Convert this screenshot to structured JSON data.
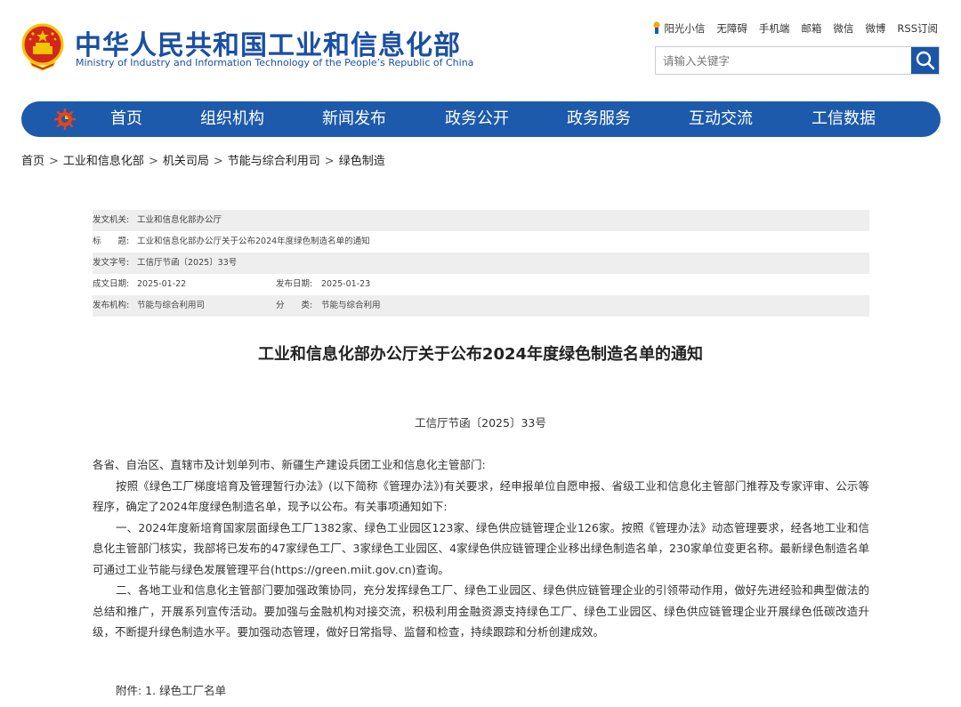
{
  "header": {
    "title_cn": "中华人民共和国工业和信息化部",
    "title_en": "Ministry of Industry and Information Technology of the People’s Republic of China",
    "top_links": [
      "阳光小信",
      "无障碍",
      "手机端",
      "邮箱",
      "微信",
      "微博",
      "RSS订阅"
    ],
    "search_placeholder": "请输入关键字"
  },
  "nav": {
    "items": [
      "首页",
      "组织机构",
      "新闻发布",
      "政务公开",
      "政务服务",
      "互动交流",
      "工信数据"
    ]
  },
  "breadcrumb": [
    "首页",
    "工业和信息化部",
    "机关司局",
    "节能与综合利用司",
    "绿色制造"
  ],
  "breadcrumb_sep": ">",
  "meta": {
    "issuer_label": "发文机关:",
    "issuer": "工业和信息化部办公厅",
    "title_label": "标　　题:",
    "title": "工业和信息化部办公厅关于公布2024年度绿色制造名单的通知",
    "docno_label": "发文字号:",
    "docno": "工信厅节函〔2025〕33号",
    "created_label": "成文日期:",
    "created": "2025-01-22",
    "published_label": "发布日期:",
    "published": "2025-01-23",
    "org_label": "发布机构:",
    "org": "节能与综合利用司",
    "category_label": "分　　类:",
    "category": "节能与综合利用"
  },
  "article": {
    "title": "工业和信息化部办公厅关于公布2024年度绿色制造名单的通知",
    "docno": "工信厅节函〔2025〕33号",
    "salutation": "各省、自治区、直辖市及计划单列市、新疆生产建设兵团工业和信息化主管部门:",
    "para1": "按照《绿色工厂梯度培育及管理暂行办法》(以下简称《管理办法》)有关要求，经申报单位自愿申报、省级工业和信息化主管部门推荐及专家评审、公示等程序，确定了2024年度绿色制造名单，现予以公布。有关事项通知如下:",
    "para2": "一、2024年度新培育国家层面绿色工厂1382家、绿色工业园区123家、绿色供应链管理企业126家。按照《管理办法》动态管理要求，经各地工业和信息化主管部门核实，我部将已发布的47家绿色工厂、3家绿色工业园区、4家绿色供应链管理企业移出绿色制造名单，230家单位变更名称。最新绿色制造名单可通过工业节能与绿色发展管理平台(https://green.miit.gov.cn)查询。",
    "para3": "二、各地工业和信息化主管部门要加强政策协同，充分发挥绿色工厂、绿色工业园区、绿色供应链管理企业的引领带动作用，做好先进经验和典型做法的总结和推广，开展系列宣传活动。要加强与金融机构对接交流，积极利用金融资源支持绿色工厂、绿色工业园区、绿色供应链管理企业开展绿色低碳改造升级，不断提升绿色制造水平。要加强动态管理，做好日常指导、监督和检查，持续跟踪和分析创建成效。",
    "attachment": "附件: 1. 绿色工厂名单"
  },
  "colors": {
    "brand_blue": "#1d5aab",
    "title_blue": "#1a4fa3",
    "emblem_red": "#d4261c",
    "emblem_gold": "#f2c500"
  }
}
